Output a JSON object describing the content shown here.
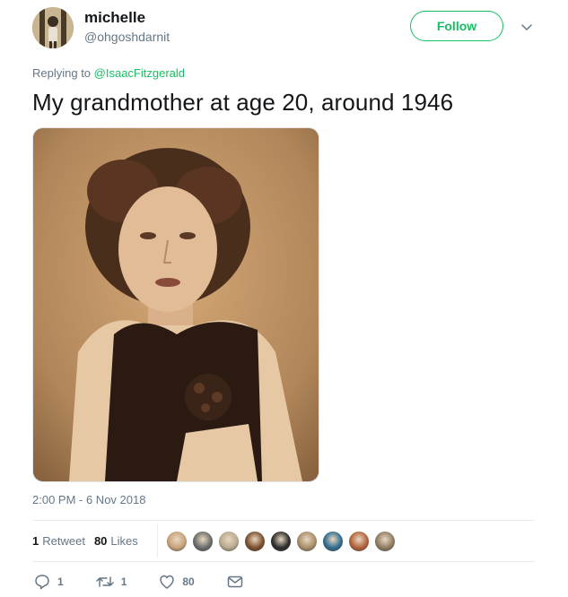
{
  "user": {
    "name": "michelle",
    "handle": "@ohgoshdarnit"
  },
  "follow_button": {
    "label": "Follow",
    "color": "#17bf63"
  },
  "menu_icon": "chevron-down-icon",
  "reply": {
    "prefix": "Replying to ",
    "mention": "@IsaacFitzgerald"
  },
  "tweet": {
    "text": "My grandmother at age 20, around 1946",
    "timestamp": "2:00 PM - 6 Nov 2018"
  },
  "stats": {
    "retweets_count": "1",
    "retweets_label": "Retweet",
    "likes_count": "80",
    "likes_label": "Likes"
  },
  "liker_avatars": [
    {
      "color": "#c8a27a"
    },
    {
      "color": "#6b6b6b"
    },
    {
      "color": "#b9a98f"
    },
    {
      "color": "#7a4e2d"
    },
    {
      "color": "#2b2b2b"
    },
    {
      "color": "#a88d6a"
    },
    {
      "color": "#2f6c8f"
    },
    {
      "color": "#b0623b"
    },
    {
      "color": "#8f7c62"
    }
  ],
  "actions": {
    "reply_count": "1",
    "retweet_count": "1",
    "like_count": "80"
  },
  "colors": {
    "accent": "#17bf63",
    "secondary_text": "#657786",
    "primary_text": "#14171a"
  }
}
